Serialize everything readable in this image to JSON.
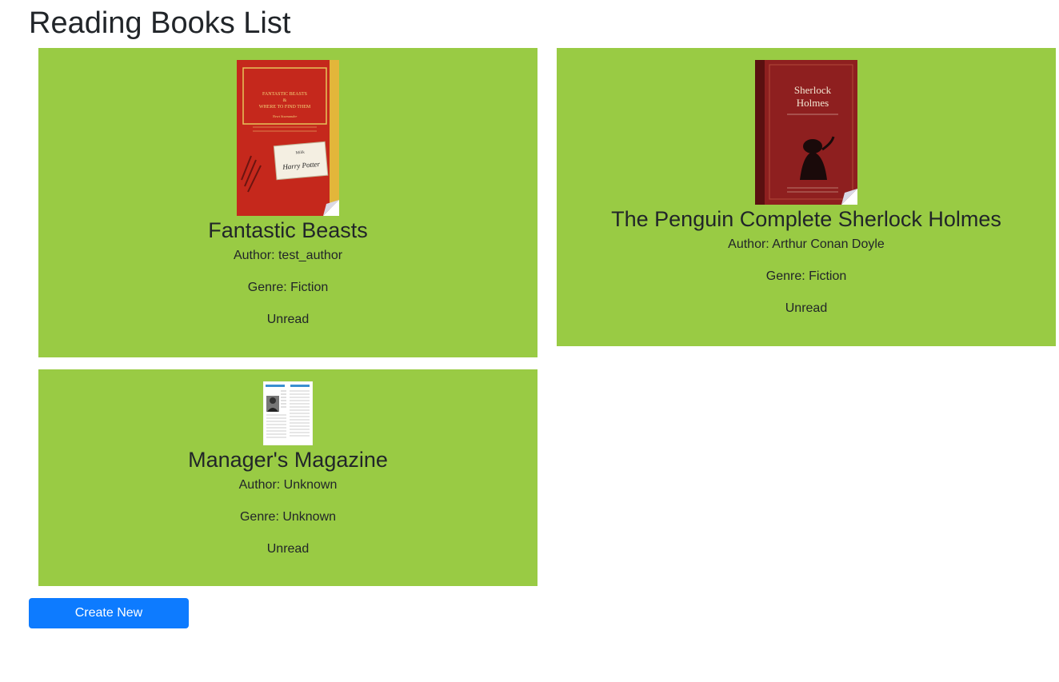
{
  "page": {
    "title": "Reading Books List"
  },
  "books": [
    {
      "title": "Fantastic Beasts",
      "author": "Author: test_author",
      "genre": "Genre: Fiction",
      "status": "Unread",
      "cover_text": [
        "FANTASTIC BEASTS",
        "&",
        "WHERE TO FIND THEM",
        "Newt Scamander",
        "Milik",
        "Harry Potter"
      ]
    },
    {
      "title": "The Penguin Complete Sherlock Holmes",
      "author": "Author: Arthur Conan Doyle",
      "genre": "Genre: Fiction",
      "status": "Unread",
      "cover_text": [
        "Sherlock",
        "Holmes"
      ]
    },
    {
      "title": "Manager's Magazine",
      "author": "Author: Unknown",
      "genre": "Genre: Unknown",
      "status": "Unread"
    }
  ],
  "actions": {
    "create_label": "Create New"
  },
  "colors": {
    "card_bg": "#99cb44",
    "button_bg": "#0d7bff"
  }
}
